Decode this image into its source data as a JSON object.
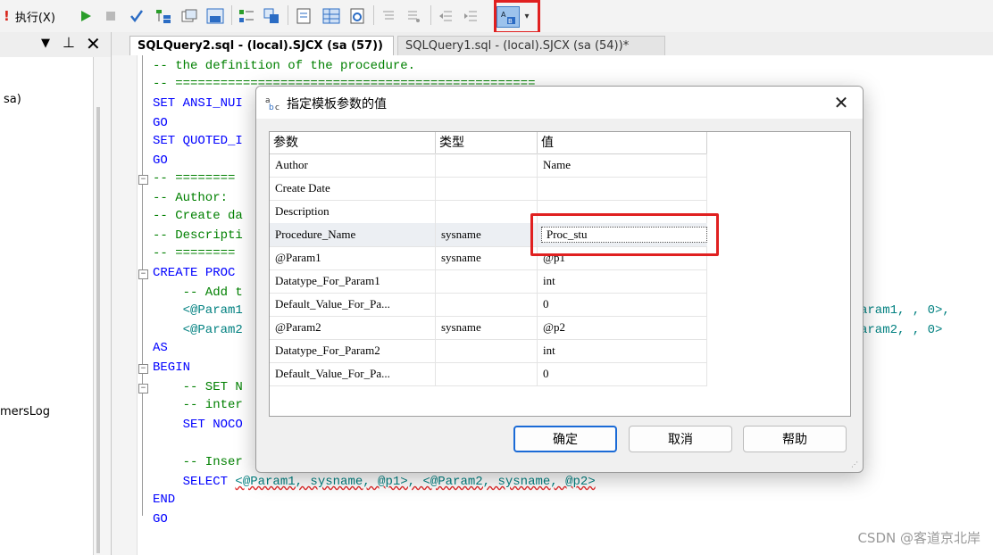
{
  "toolbar": {
    "execute_label": "执行(X)",
    "colors": {
      "green": "#2a9d2a",
      "blue": "#2b6cc4",
      "accent": "#1f7fd8"
    }
  },
  "left_panel": {
    "item_sa": "sa)",
    "item_log": "mersLog"
  },
  "tabs": [
    {
      "label": "SQLQuery2.sql - (local).SJCX (sa (57))"
    },
    {
      "label": "SQLQuery1.sql - (local).SJCX (sa (54))*"
    }
  ],
  "code": {
    "l1": "-- the definition of the procedure.",
    "l2": "-- ================================================",
    "l3a": "SET ",
    "l3b": "ANSI_NUI",
    "l4": "GO",
    "l5a": "SET ",
    "l5b": "QUOTED_I",
    "l6": "GO",
    "l7": "-- ========",
    "l8": "-- Author:",
    "l9": "-- Create da",
    "l10": "-- Descripti",
    "l11": "-- ========",
    "l12a": "CREATE ",
    "l12b": "PROC",
    "l13": "    -- Add t",
    "l14": "    <@Param1",
    "l14r": "aram1, , 0>,",
    "l15": "    <@Param2",
    "l15r": "aram2, , 0>",
    "l16": "AS",
    "l17": "BEGIN",
    "l18": "    -- SET N",
    "l19": "    -- inter",
    "l20a": "    SET ",
    "l20b": "NOCO",
    "l21": "    -- Inser",
    "l22a": "    SELECT ",
    "l22b": "<@Param1, sysname, @p1>, <@Param2, sysname, @p2>",
    "l23": "END",
    "l24": "GO"
  },
  "dialog": {
    "title": "指定模板参数的值",
    "columns": [
      "参数",
      "类型",
      "值"
    ],
    "rows": [
      {
        "param": "Author",
        "type": "",
        "value": "Name"
      },
      {
        "param": "Create Date",
        "type": "",
        "value": ""
      },
      {
        "param": "Description",
        "type": "",
        "value": ""
      },
      {
        "param": "Procedure_Name",
        "type": "sysname",
        "value": "Proc_stu"
      },
      {
        "param": "@Param1",
        "type": "sysname",
        "value": "@p1"
      },
      {
        "param": "Datatype_For_Param1",
        "type": "",
        "value": "int"
      },
      {
        "param": "Default_Value_For_Pa...",
        "type": "",
        "value": "0"
      },
      {
        "param": "@Param2",
        "type": "sysname",
        "value": "@p2"
      },
      {
        "param": "Datatype_For_Param2",
        "type": "",
        "value": "int"
      },
      {
        "param": "Default_Value_For_Pa...",
        "type": "",
        "value": "0"
      }
    ],
    "buttons": {
      "ok": "确定",
      "cancel": "取消",
      "help": "帮助"
    }
  },
  "watermark": "CSDN @客道京北岸"
}
